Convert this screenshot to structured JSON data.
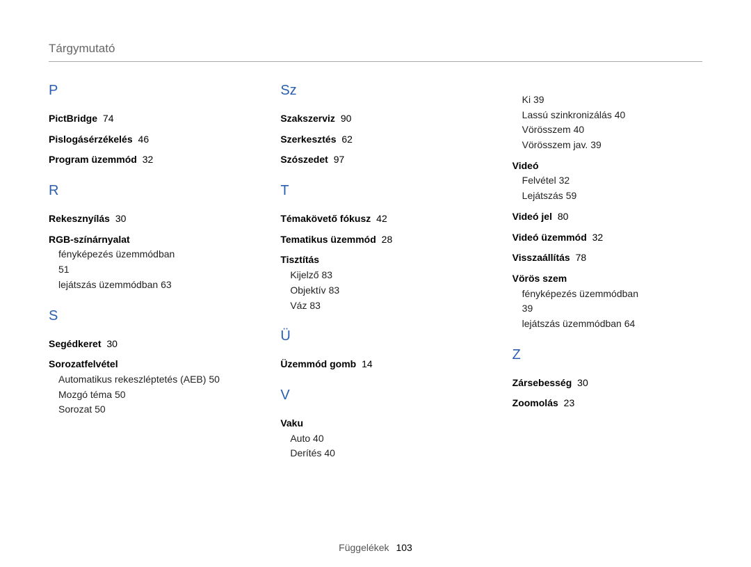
{
  "header": "Tárgymutató",
  "footer_label": "Függelékek",
  "footer_page": "103",
  "columns": [
    [
      {
        "type": "letter",
        "text": "P"
      },
      {
        "type": "entry",
        "label": "PictBridge",
        "page": "74"
      },
      {
        "type": "entry",
        "label": "Pislogásérzékelés",
        "page": "46"
      },
      {
        "type": "entry",
        "label": "Program üzemmód",
        "page": "32"
      },
      {
        "type": "letter",
        "text": "R"
      },
      {
        "type": "entry",
        "label": "Rekesznyílás",
        "page": "30"
      },
      {
        "type": "entry",
        "label": "RGB-színárnyalat",
        "page": ""
      },
      {
        "type": "sub",
        "label": "fényképezés üzemmódban",
        "page": "51",
        "breakPage": true
      },
      {
        "type": "sub",
        "label": "lejátszás üzemmódban",
        "page": "63"
      },
      {
        "type": "letter",
        "text": "S"
      },
      {
        "type": "entry",
        "label": "Segédkeret",
        "page": "30"
      },
      {
        "type": "entry",
        "label": "Sorozatfelvétel",
        "page": ""
      },
      {
        "type": "sub",
        "label": "Automatikus rekeszléptetés (AEB)",
        "page": "50"
      },
      {
        "type": "sub",
        "label": "Mozgó téma",
        "page": "50"
      },
      {
        "type": "sub",
        "label": "Sorozat",
        "page": "50"
      }
    ],
    [
      {
        "type": "letter",
        "text": "Sz"
      },
      {
        "type": "entry",
        "label": "Szakszerviz",
        "page": "90"
      },
      {
        "type": "entry",
        "label": "Szerkesztés",
        "page": "62"
      },
      {
        "type": "entry",
        "label": "Szószedet",
        "page": "97"
      },
      {
        "type": "letter",
        "text": "T"
      },
      {
        "type": "entry",
        "label": "Témakövető fókusz",
        "page": "42"
      },
      {
        "type": "entry",
        "label": "Tematikus üzemmód",
        "page": "28"
      },
      {
        "type": "entry",
        "label": "Tisztítás",
        "page": ""
      },
      {
        "type": "sub",
        "label": "Kijelző",
        "page": "83"
      },
      {
        "type": "sub",
        "label": "Objektív",
        "page": "83"
      },
      {
        "type": "sub",
        "label": "Váz",
        "page": "83"
      },
      {
        "type": "letter",
        "text": "Ü"
      },
      {
        "type": "entry",
        "label": "Üzemmód gomb",
        "page": "14"
      },
      {
        "type": "letter",
        "text": "V"
      },
      {
        "type": "entry",
        "label": "Vaku",
        "page": ""
      },
      {
        "type": "sub",
        "label": "Auto",
        "page": "40"
      },
      {
        "type": "sub",
        "label": "Derítés",
        "page": "40"
      }
    ],
    [
      {
        "type": "sub",
        "label": "Ki",
        "page": "39"
      },
      {
        "type": "sub",
        "label": "Lassú szinkronizálás",
        "page": "40"
      },
      {
        "type": "sub",
        "label": "Vörösszem",
        "page": "40"
      },
      {
        "type": "sub",
        "label": "Vörösszem jav.",
        "page": "39"
      },
      {
        "type": "entry",
        "label": "Videó",
        "page": ""
      },
      {
        "type": "sub",
        "label": "Felvétel",
        "page": "32"
      },
      {
        "type": "sub",
        "label": "Lejátszás",
        "page": "59"
      },
      {
        "type": "entry",
        "label": "Videó jel",
        "page": "80"
      },
      {
        "type": "entry",
        "label": "Videó üzemmód",
        "page": "32"
      },
      {
        "type": "entry",
        "label": "Visszaállítás",
        "page": "78"
      },
      {
        "type": "entry",
        "label": "Vörös szem",
        "page": ""
      },
      {
        "type": "sub",
        "label": "fényképezés üzemmódban",
        "page": "39",
        "breakPage": true
      },
      {
        "type": "sub",
        "label": "lejátszás üzemmódban",
        "page": "64"
      },
      {
        "type": "letter",
        "text": "Z"
      },
      {
        "type": "entry",
        "label": "Zársebesség",
        "page": "30"
      },
      {
        "type": "entry",
        "label": "Zoomolás",
        "page": "23"
      }
    ]
  ]
}
